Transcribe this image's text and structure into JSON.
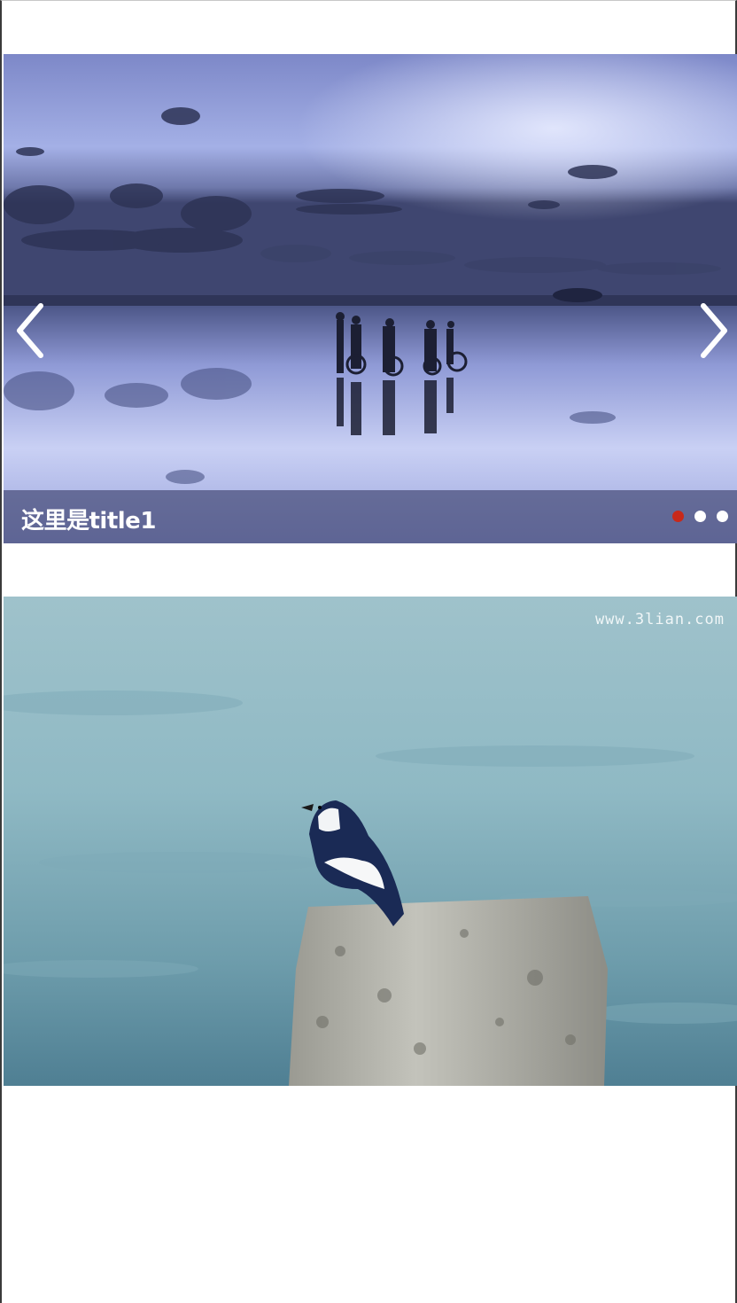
{
  "carousel": {
    "caption": "这里是title1",
    "slides": [
      {
        "id": "slide-1",
        "active": true
      },
      {
        "id": "slide-2",
        "active": false
      },
      {
        "id": "slide-3",
        "active": false
      }
    ],
    "prev_icon": "chevron-left-icon",
    "next_icon": "chevron-right-icon",
    "colors": {
      "active_dot": "#c8291a",
      "dot": "#ffffff"
    }
  },
  "second_image": {
    "watermark": "www.3lian.com"
  }
}
